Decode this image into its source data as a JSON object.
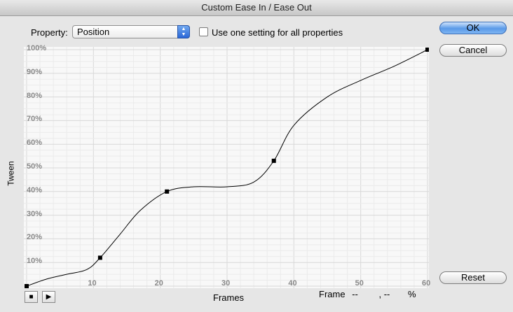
{
  "window": {
    "title": "Custom Ease In / Ease Out"
  },
  "property": {
    "label": "Property:",
    "value": "Position"
  },
  "checkbox": {
    "label": "Use one setting for all properties",
    "checked": false
  },
  "buttons": {
    "ok": "OK",
    "cancel": "Cancel",
    "reset": "Reset"
  },
  "chart_data": {
    "type": "line",
    "xlabel": "Frames",
    "ylabel": "Tween",
    "xticks": [
      "10",
      "20",
      "30",
      "40",
      "50",
      "60"
    ],
    "yticks": [
      "10%",
      "20%",
      "30%",
      "40%",
      "50%",
      "60%",
      "70%",
      "80%",
      "90%",
      "100%"
    ],
    "xlim": [
      0,
      60
    ],
    "ylim": [
      0,
      100
    ],
    "grid": true,
    "control_points": [
      {
        "x": 0,
        "y": 0
      },
      {
        "x": 11,
        "y": 12
      },
      {
        "x": 21,
        "y": 40
      },
      {
        "x": 37,
        "y": 53
      },
      {
        "x": 60,
        "y": 100
      }
    ],
    "curve": [
      {
        "x": 0,
        "y": 0
      },
      {
        "x": 3,
        "y": 3
      },
      {
        "x": 6,
        "y": 5
      },
      {
        "x": 9,
        "y": 7
      },
      {
        "x": 11,
        "y": 12
      },
      {
        "x": 14,
        "y": 22
      },
      {
        "x": 17,
        "y": 32
      },
      {
        "x": 21,
        "y": 40
      },
      {
        "x": 25,
        "y": 42
      },
      {
        "x": 30,
        "y": 42
      },
      {
        "x": 34,
        "y": 44
      },
      {
        "x": 37,
        "y": 53
      },
      {
        "x": 40,
        "y": 68
      },
      {
        "x": 45,
        "y": 80
      },
      {
        "x": 50,
        "y": 87
      },
      {
        "x": 55,
        "y": 93
      },
      {
        "x": 60,
        "y": 100
      }
    ]
  },
  "frame_readout": {
    "label": "Frame",
    "value1": "--",
    "value2": ", --",
    "unit": "%"
  },
  "icons": {
    "stop": "stop-icon",
    "play": "play-icon"
  }
}
